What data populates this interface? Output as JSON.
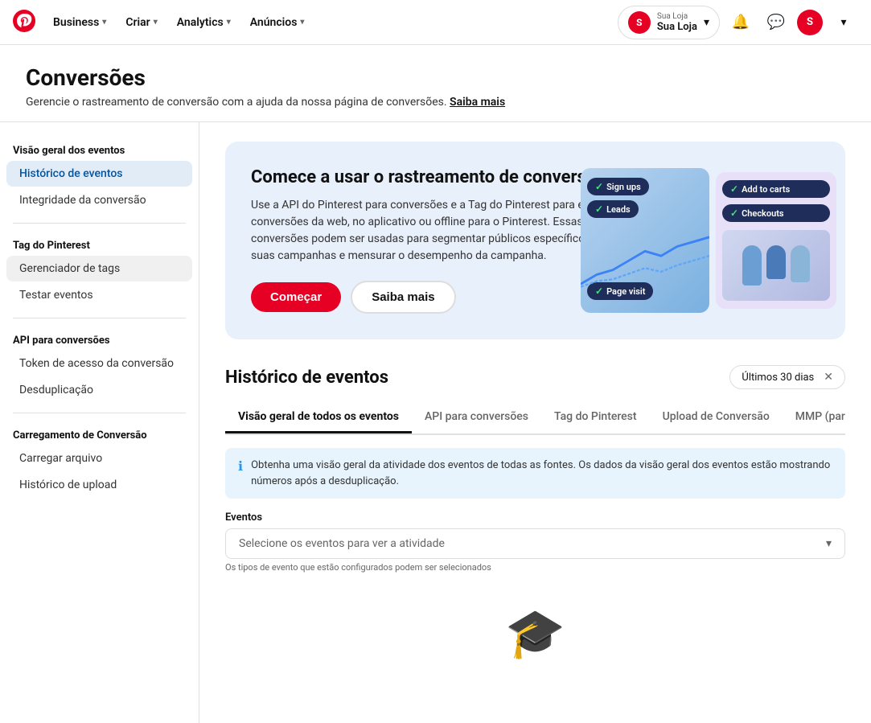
{
  "brand": {
    "name": "Pinterest",
    "logo_color": "#e60023"
  },
  "topnav": {
    "items": [
      {
        "id": "business",
        "label": "Business",
        "has_chevron": true
      },
      {
        "id": "criar",
        "label": "Criar",
        "has_chevron": true
      },
      {
        "id": "analytics",
        "label": "Analytics",
        "has_chevron": true
      },
      {
        "id": "anuncios",
        "label": "Anúncios",
        "has_chevron": true
      }
    ],
    "account": {
      "short": "S",
      "name_small": "Sua Loja",
      "name_main": "Sua Loja",
      "avatar_initial": "S"
    }
  },
  "page": {
    "title": "Conversões",
    "subtitle": "Gerencie o rastreamento de conversão com a ajuda da nossa página de conversões.",
    "subtitle_link": "Saiba mais"
  },
  "sidebar": {
    "sections": [
      {
        "id": "eventos",
        "label": "Visão geral dos eventos",
        "items": [
          {
            "id": "historico-eventos",
            "label": "Histórico de eventos",
            "active": true
          },
          {
            "id": "integridade",
            "label": "Integridade da conversão"
          }
        ]
      },
      {
        "id": "tag",
        "label": "Tag do Pinterest",
        "items": [
          {
            "id": "gerenciador-tags",
            "label": "Gerenciador de tags",
            "hovered": true
          },
          {
            "id": "testar-eventos",
            "label": "Testar eventos"
          }
        ]
      },
      {
        "id": "api",
        "label": "API para conversões",
        "items": [
          {
            "id": "token-acesso",
            "label": "Token de acesso da conversão"
          },
          {
            "id": "desduplicacao",
            "label": "Desduplicação"
          }
        ]
      },
      {
        "id": "carregamento",
        "label": "Carregamento de Conversão",
        "items": [
          {
            "id": "carregar-arquivo",
            "label": "Carregar arquivo"
          },
          {
            "id": "historico-upload",
            "label": "Histórico de upload"
          }
        ]
      }
    ]
  },
  "promo": {
    "title": "Comece a usar o rastreamento de conversão",
    "description": "Use a API do Pinterest para conversões e a Tag do Pinterest para enviar conversões da web, no aplicativo ou offline para o Pinterest. Essas conversões podem ser usadas para segmentar públicos específicos para suas campanhas e mensurar o desempenho da campanha.",
    "btn_start": "Começar",
    "btn_learn": "Saiba mais",
    "badges": [
      {
        "id": "sign-ups",
        "label": "Sign ups"
      },
      {
        "id": "leads",
        "label": "Leads"
      },
      {
        "id": "add-to-carts",
        "label": "Add to carts"
      },
      {
        "id": "checkouts",
        "label": "Checkouts"
      },
      {
        "id": "page-visit",
        "label": "Page visit"
      }
    ]
  },
  "events_section": {
    "title": "Histórico de eventos",
    "date_filter": "Últimos 30 dias",
    "tabs": [
      {
        "id": "visao-geral",
        "label": "Visão geral de todos os eventos",
        "active": true
      },
      {
        "id": "api-conversoes",
        "label": "API para conversões"
      },
      {
        "id": "tag-pinterest",
        "label": "Tag do Pinterest"
      },
      {
        "id": "upload-conversao",
        "label": "Upload de Conversão"
      },
      {
        "id": "mmp",
        "label": "MMP (parceiro de mensura..."
      }
    ],
    "info_text_start": "Obtenha uma visão geral da atividade dos eventos de todas as fontes.",
    "info_text_end": " Os dados da visão geral dos eventos estão mostrando números após a desduplicação.",
    "eventos_label": "Eventos",
    "select_placeholder": "Selecione os eventos para ver a atividade",
    "hint": "Os tipos de evento que estão configurados podem ser selecionados"
  }
}
